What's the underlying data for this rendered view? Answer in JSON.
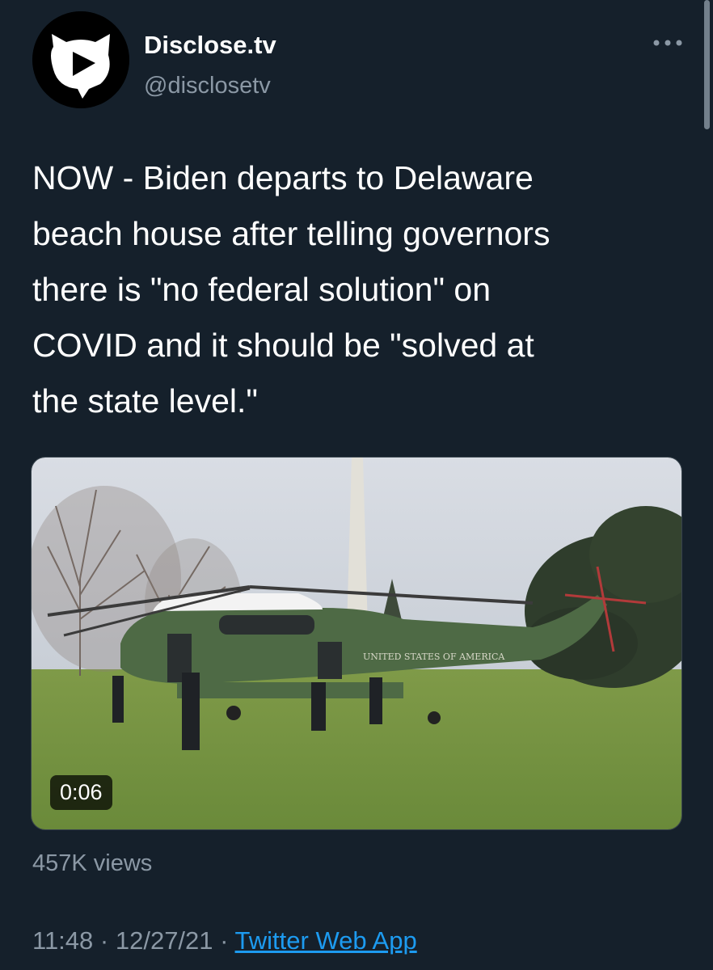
{
  "account": {
    "display_name": "Disclose.tv",
    "handle": "@disclosetv",
    "avatar_icon": "disclose-cat-play-logo-icon"
  },
  "menu": {
    "more_label": "•••"
  },
  "tweet": {
    "text": "NOW - Biden departs to Delaware\nbeach house after telling governors\nthere is \"no federal solution\" on\nCOVID and it should be \"solved at\nthe state level.\""
  },
  "media": {
    "type": "video",
    "duration": "0:06",
    "helicopter_lettering": "UNITED STATES OF AMERICA"
  },
  "stats": {
    "views": "457K views"
  },
  "footer": {
    "time": "11:48",
    "separator": "·",
    "date": "12/27/21",
    "source": "Twitter Web App"
  },
  "colors": {
    "background": "#15202b",
    "secondary_text": "#8b98a5",
    "link": "#1d9bf0"
  }
}
